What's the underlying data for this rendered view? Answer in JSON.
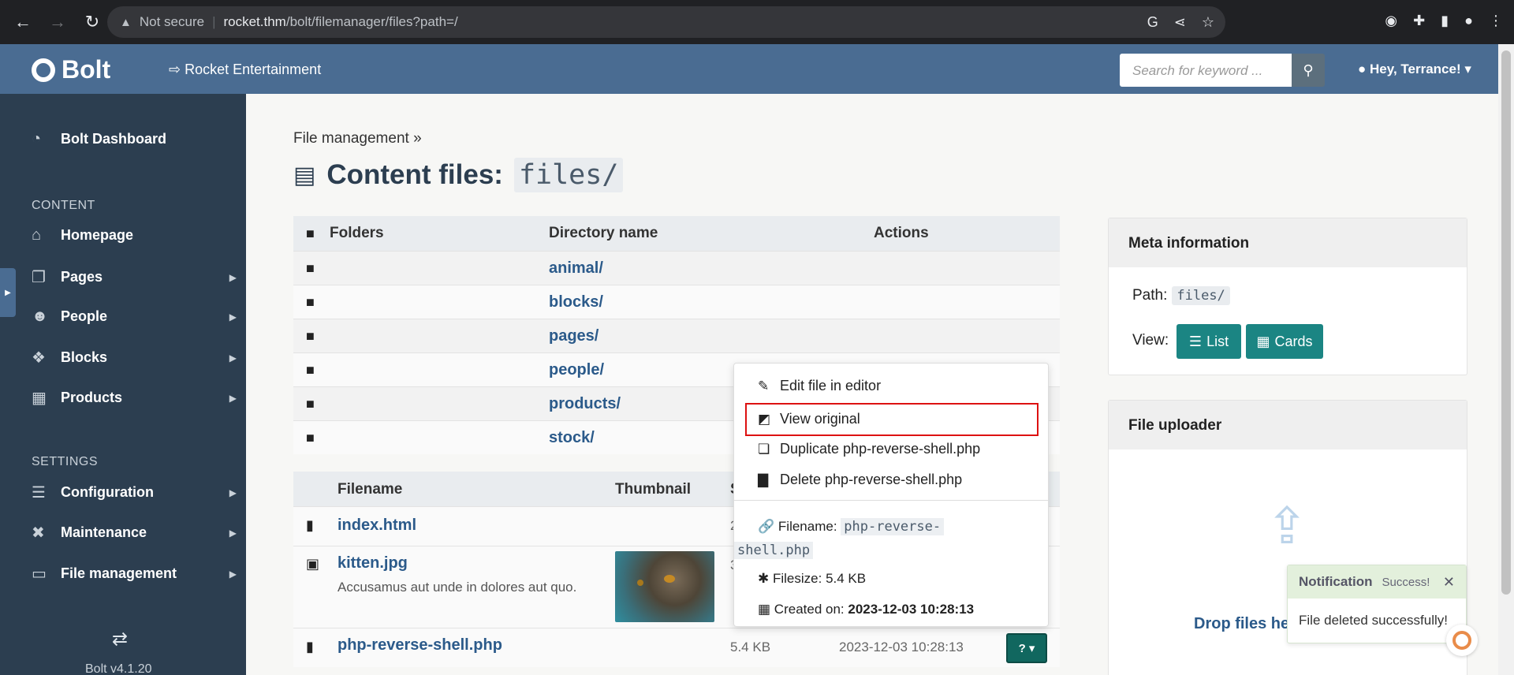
{
  "browser": {
    "security": "Not secure",
    "host": "rocket.thm",
    "path": "/bolt/filemanager/files?path=/"
  },
  "header": {
    "brand": "Bolt",
    "site_link": "Rocket Entertainment",
    "search_placeholder": "Search for keyword ...",
    "user": "Hey, Terrance!"
  },
  "sidebar": {
    "dashboard": "Bolt Dashboard",
    "content_heading": "CONTENT",
    "settings_heading": "SETTINGS",
    "items": [
      {
        "label": "Homepage"
      },
      {
        "label": "Pages"
      },
      {
        "label": "People"
      },
      {
        "label": "Blocks"
      },
      {
        "label": "Products"
      },
      {
        "label": "Configuration"
      },
      {
        "label": "Maintenance"
      },
      {
        "label": "File management"
      }
    ],
    "version": "Bolt v4.1.20"
  },
  "main": {
    "breadcrumb": "File management »",
    "title": "Content files:",
    "title_path": "files/",
    "folders_header": {
      "folders": "Folders",
      "directory": "Directory name",
      "actions": "Actions"
    },
    "folders": [
      "animal/",
      "blocks/",
      "pages/",
      "people/",
      "products/",
      "stock/"
    ],
    "files_header": {
      "filename": "Filename",
      "thumbnail": "Thumbnail",
      "size": "S"
    },
    "files": [
      {
        "name": "index.html",
        "size": "2",
        "date": ""
      },
      {
        "name": "kitten.jpg",
        "desc": "Accusamus aut unde in dolores aut quo.",
        "size": "3",
        "date": ""
      },
      {
        "name": "php-reverse-shell.php",
        "size": "5.4 KB",
        "date": "2023-12-03 10:28:13"
      }
    ]
  },
  "context_menu": {
    "edit": "Edit file in editor",
    "view": "View original",
    "duplicate": "Duplicate php-reverse-shell.php",
    "delete": "Delete php-reverse-shell.php",
    "filename_label": "Filename:",
    "filename_l1": "php-reverse-",
    "filename_l2": "shell.php",
    "filesize_label": "Filesize:",
    "filesize": "5.4 KB",
    "created_label": "Created on:",
    "created": "2023-12-03 10:28:13"
  },
  "meta_panel": {
    "title": "Meta information",
    "path_label": "Path:",
    "path": "files/",
    "view_label": "View:",
    "list": "List",
    "cards": "Cards"
  },
  "uploader": {
    "title": "File uploader",
    "drop": "Drop files here to upload"
  },
  "notification": {
    "title": "Notification",
    "status": "Success!",
    "message": "File deleted successfully!"
  },
  "colors": {
    "header": "#4a6c92",
    "sidebar": "#2c3e50",
    "accent": "#1b8583",
    "link": "#2b5a8a",
    "highlight": "#dd1111"
  }
}
